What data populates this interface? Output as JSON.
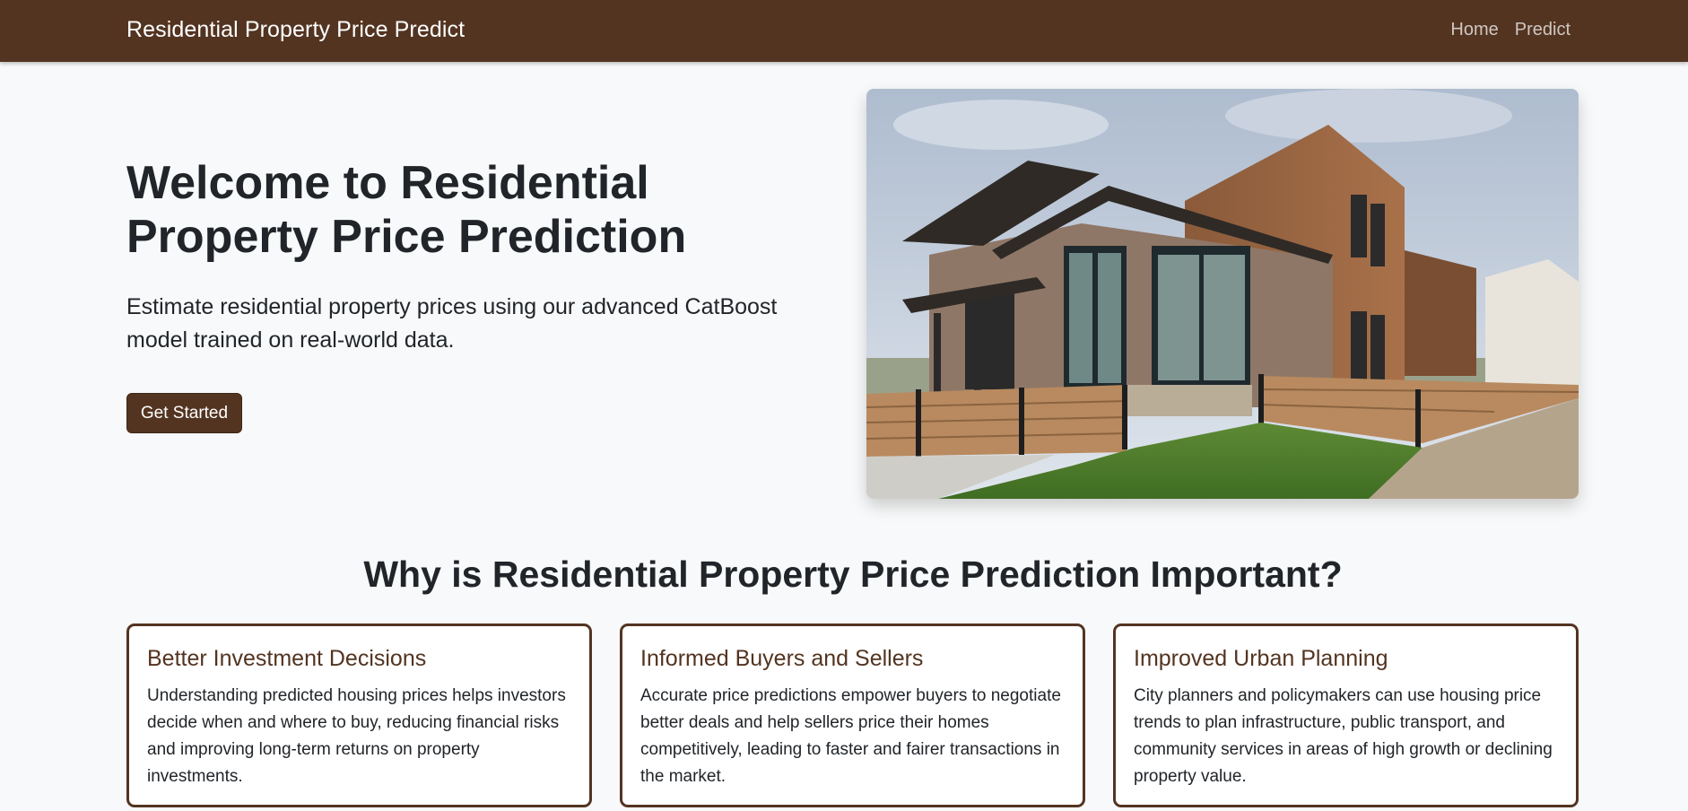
{
  "navbar": {
    "brand": "Residential Property Price Predict",
    "links": [
      "Home",
      "Predict"
    ]
  },
  "hero": {
    "title": "Welcome to Residential Property Price Prediction",
    "lead": "Estimate residential property prices using our advanced CatBoost model trained on real-world data.",
    "cta_label": "Get Started",
    "image": "modern-townhouse-photo"
  },
  "importance": {
    "title": "Why is Residential Property Price Prediction Important?",
    "cards": [
      {
        "title": "Better Investment Decisions",
        "text": "Understanding predicted housing prices helps investors decide when and where to buy, reducing financial risks and improving long-term returns on property investments."
      },
      {
        "title": "Informed Buyers and Sellers",
        "text": "Accurate price predictions empower buyers to negotiate better deals and help sellers price their homes competitively, leading to faster and fairer transactions in the market."
      },
      {
        "title": "Improved Urban Planning",
        "text": "City planners and policymakers can use housing price trends to plan infrastructure, public transport, and community services in areas of high growth or declining property value."
      }
    ]
  },
  "colors": {
    "brand": "#533421",
    "background": "#f8f9fa",
    "text": "#212529"
  }
}
